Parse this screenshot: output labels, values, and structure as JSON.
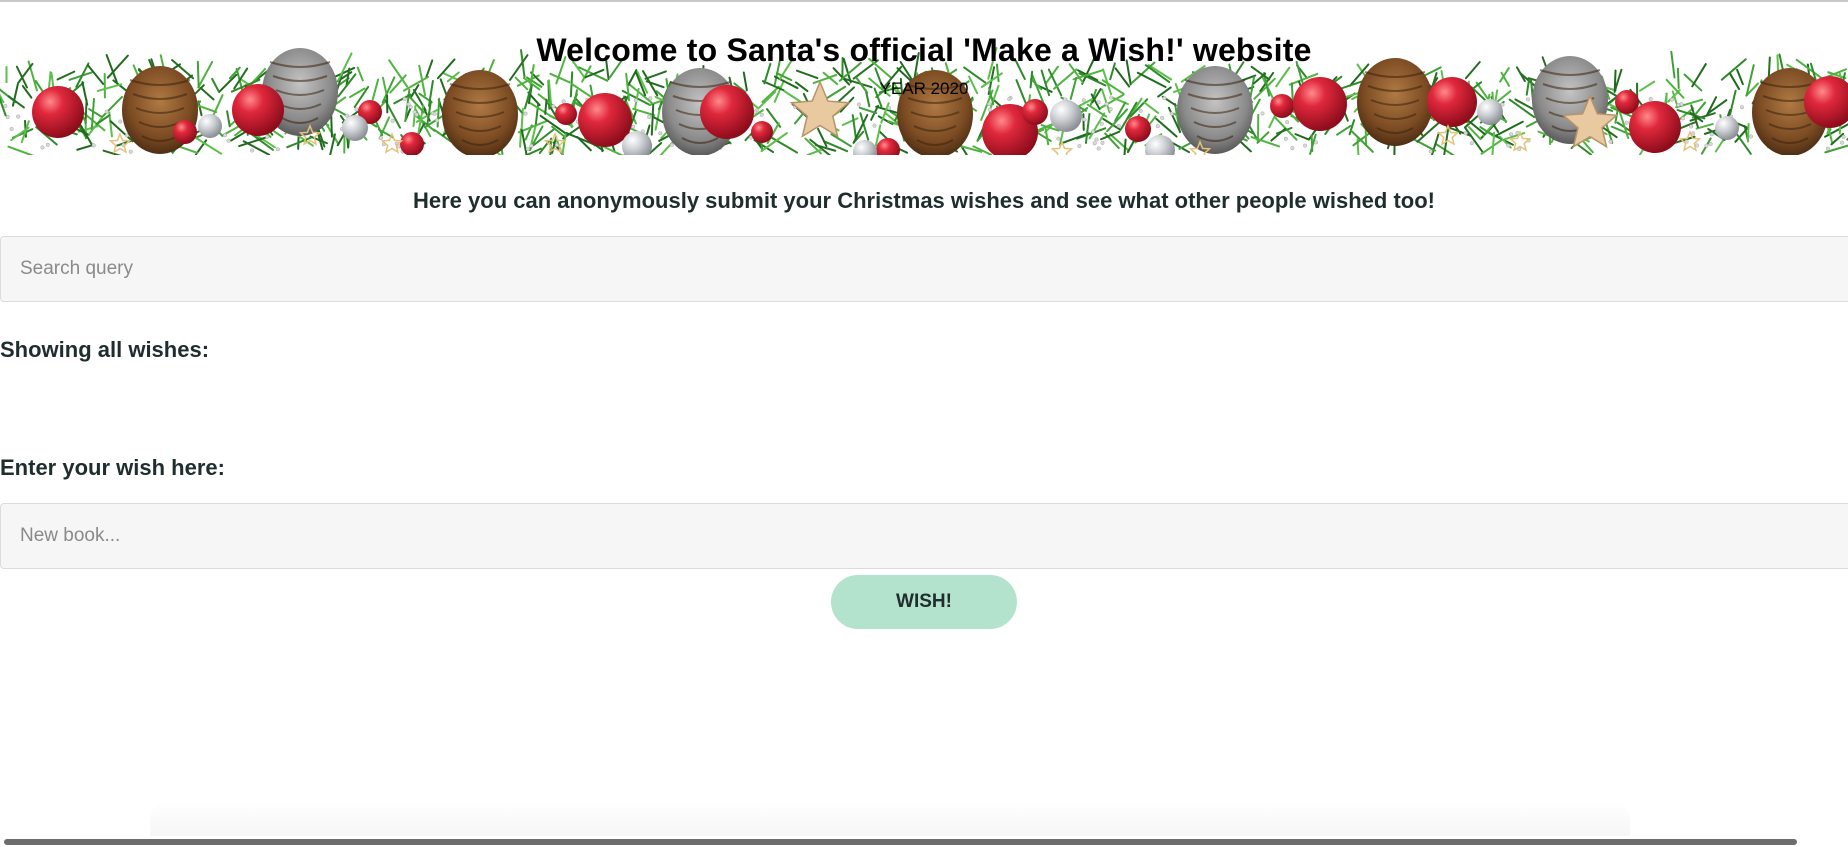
{
  "header": {
    "title": "Welcome to Santa's official 'Make a Wish!' website",
    "subtitle": "YEAR 2020"
  },
  "intro": {
    "text": "Here you can anonymously submit your Christmas wishes and see what other people wished too!"
  },
  "search": {
    "placeholder": "Search query",
    "value": ""
  },
  "wishes": {
    "heading": "Showing all wishes:",
    "items": []
  },
  "wish_form": {
    "label": "Enter your wish here:",
    "placeholder": "New book...",
    "value": "",
    "button_label": "WISH!"
  },
  "colors": {
    "button_bg": "#b3e3cc",
    "input_bg": "#f6f6f6",
    "text_dark": "#1f2d2d",
    "ornament_red": "#d01f33",
    "ornament_silver": "#c9ccd0",
    "pine_green": "#2f8a2a",
    "pinecone_brown": "#8a5a2b"
  },
  "icons": {
    "banner": "christmas-garland-banner"
  }
}
